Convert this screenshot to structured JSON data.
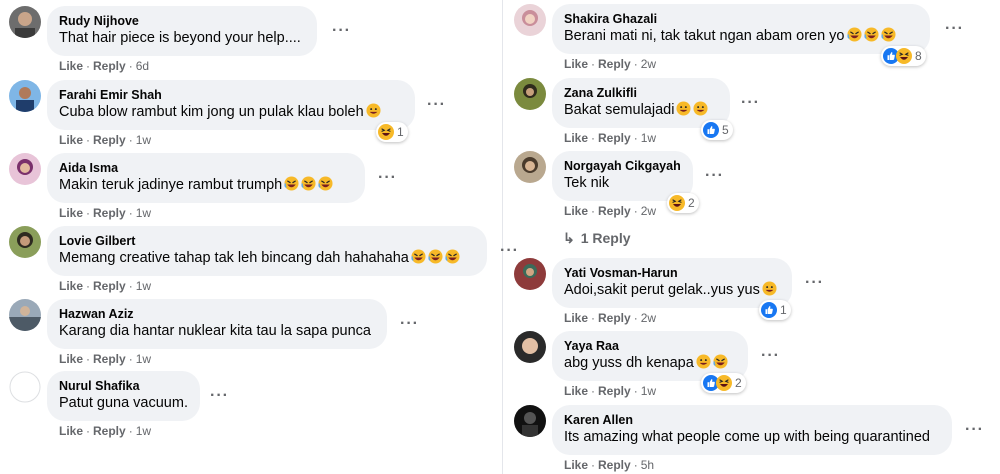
{
  "common": {
    "like_label": "Like",
    "reply_label": "Reply",
    "separator": "·",
    "more_label": "···"
  },
  "left": [
    {
      "author": "Rudy Nijhove",
      "text": "That hair piece is beyond your help....",
      "emojis": [],
      "time": "6d",
      "reactions": null
    },
    {
      "author": "Farahi Emir Shah",
      "text": "Cuba blow rambut kim jong un pulak klau boleh",
      "emojis": [
        "grin"
      ],
      "time": "1w",
      "reactions": {
        "icons": [
          "haha"
        ],
        "count": "1"
      }
    },
    {
      "author": "Aida Isma",
      "text": "Makin teruk jadinye rambut trumph",
      "emojis": [
        "rofl",
        "rofl",
        "rofl"
      ],
      "time": "1w",
      "reactions": null
    },
    {
      "author": "Lovie Gilbert",
      "text": "Memang creative tahap tak leh bincang dah hahahaha",
      "emojis": [
        "rofl",
        "rofl",
        "rofl"
      ],
      "time": "1w",
      "reactions": null
    },
    {
      "author": "Hazwan Aziz",
      "text": "Karang dia hantar nuklear kita tau la sapa punca",
      "emojis": [],
      "time": "1w",
      "reactions": null
    },
    {
      "author": "Nurul Shafika",
      "text": "Patut guna vacuum.",
      "emojis": [],
      "time": "1w",
      "reactions": null
    }
  ],
  "right": [
    {
      "author": "Shakira Ghazali",
      "text": "Berani mati ni, tak takut ngan abam oren yo",
      "emojis": [
        "rofl",
        "rofl",
        "rofl"
      ],
      "time": "2w",
      "reactions": {
        "icons": [
          "like",
          "haha"
        ],
        "count": "8"
      }
    },
    {
      "author": "Zana Zulkifli",
      "text": "Bakat semulajadi",
      "emojis": [
        "grin",
        "grin"
      ],
      "time": "1w",
      "reactions": {
        "icons": [
          "like"
        ],
        "count": "5"
      }
    },
    {
      "author": "Norgayah Cikgayah",
      "text": "Tek nik",
      "emojis": [],
      "time": "2w",
      "reactions": {
        "icons": [
          "haha"
        ],
        "count": "2"
      }
    },
    {
      "author": "Yati Vosman-Harun",
      "text": "Adoi,sakit perut gelak..yus yus",
      "emojis": [
        "grin"
      ],
      "time": "2w",
      "reactions": {
        "icons": [
          "like"
        ],
        "count": "1"
      }
    },
    {
      "author": "Yaya Raa",
      "text": "abg yuss dh kenapa",
      "emojis": [
        "grin",
        "rofl"
      ],
      "time": "1w",
      "reactions": {
        "icons": [
          "like",
          "haha"
        ],
        "count": "2"
      }
    },
    {
      "author": "Karen Allen",
      "text": "Its amazing what people come up with being quarantined",
      "emojis": [],
      "time": "5h",
      "reactions": null
    }
  ],
  "replies_link": {
    "label": "1 Reply"
  },
  "colors": {
    "like_blue": "#1877f2",
    "haha_yellow": "#f7b928",
    "bubble_bg": "#f0f2f5",
    "meta_gray": "#65676b"
  }
}
